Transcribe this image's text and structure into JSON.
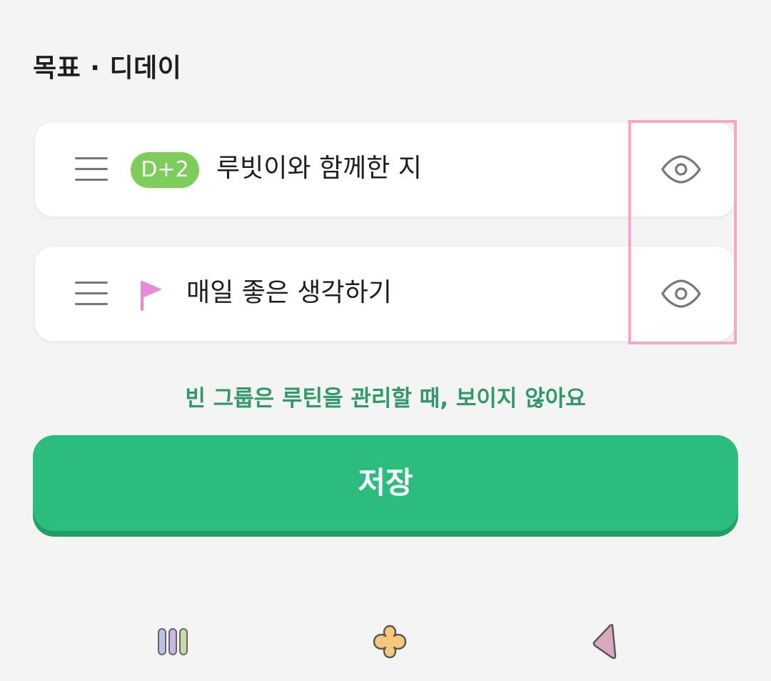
{
  "header": {
    "title": "목표 · 디데이"
  },
  "items": [
    {
      "badge": "D+2",
      "badge_color": "#7ccd5a",
      "label": "루빗이와 함께한 지",
      "drag_icon": "drag-handle-icon",
      "visibility_icon": "eye-icon"
    },
    {
      "label": "매일 좋은 생각하기",
      "flag_color": "#e98ad8",
      "drag_icon": "drag-handle-icon",
      "visibility_icon": "eye-icon"
    }
  ],
  "info_text": "빈 그룹은 루틴을 관리할 때, 보이지 않아요",
  "save_button": {
    "label": "저장",
    "color": "#2bbd7e"
  },
  "bottom_nav": [
    {
      "icon": "routine-bars-icon"
    },
    {
      "icon": "clover-icon"
    },
    {
      "icon": "triangle-icon"
    }
  ],
  "colors": {
    "background": "#f4f4f4",
    "accent_green": "#2bbd7e",
    "info_text": "#2f9a67",
    "highlight": "#f7a8c9"
  }
}
